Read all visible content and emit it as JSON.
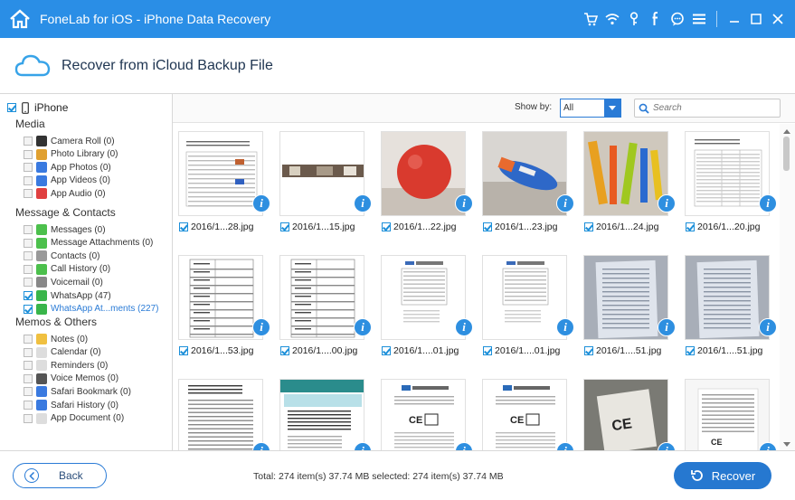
{
  "app": {
    "title": "FoneLab for iOS - iPhone Data Recovery"
  },
  "titlebar": {
    "tools": [
      {
        "name": "cart-icon",
        "glyph": "🛒"
      },
      {
        "name": "wifi-icon",
        "glyph": "≋"
      },
      {
        "name": "key-icon",
        "glyph": "♀"
      },
      {
        "name": "facebook-icon",
        "glyph": "f"
      },
      {
        "name": "chat-icon",
        "glyph": "☺"
      },
      {
        "name": "menu-icon",
        "glyph": "≡"
      }
    ],
    "window": [
      {
        "name": "minimize-button",
        "glyph": "—"
      },
      {
        "name": "maximize-button",
        "glyph": "☐"
      },
      {
        "name": "close-button",
        "glyph": "✕"
      }
    ]
  },
  "header": {
    "title": "Recover from iCloud Backup File"
  },
  "sidebar": {
    "root_label": "iPhone",
    "groups": [
      {
        "title": "Media",
        "items": [
          {
            "label": "Camera Roll (0)",
            "icon_color": "#333333",
            "checked": false
          },
          {
            "label": "Photo Library (0)",
            "icon_color": "#e0a030",
            "checked": false
          },
          {
            "label": "App Photos (0)",
            "icon_color": "#3a7ae0",
            "checked": false
          },
          {
            "label": "App Videos (0)",
            "icon_color": "#3a7ae0",
            "checked": false
          },
          {
            "label": "App Audio (0)",
            "icon_color": "#e04040",
            "checked": false
          }
        ]
      },
      {
        "title": "Message & Contacts",
        "items": [
          {
            "label": "Messages (0)",
            "icon_color": "#4cc04c",
            "checked": false
          },
          {
            "label": "Message Attachments (0)",
            "icon_color": "#4cc04c",
            "checked": false
          },
          {
            "label": "Contacts (0)",
            "icon_color": "#999999",
            "checked": false
          },
          {
            "label": "Call History (0)",
            "icon_color": "#4cc04c",
            "checked": false
          },
          {
            "label": "Voicemail (0)",
            "icon_color": "#888888",
            "checked": false
          },
          {
            "label": "WhatsApp (47)",
            "icon_color": "#39b54a",
            "checked": true
          },
          {
            "label": "WhatsApp At...ments (227)",
            "icon_color": "#39b54a",
            "checked": true
          }
        ]
      },
      {
        "title": "Memos & Others",
        "items": [
          {
            "label": "Notes (0)",
            "icon_color": "#f0c040",
            "checked": false
          },
          {
            "label": "Calendar (0)",
            "icon_color": "#dddddd",
            "checked": false
          },
          {
            "label": "Reminders (0)",
            "icon_color": "#dddddd",
            "checked": false
          },
          {
            "label": "Voice Memos (0)",
            "icon_color": "#555555",
            "checked": false
          },
          {
            "label": "Safari Bookmark (0)",
            "icon_color": "#3a7ae0",
            "checked": false
          },
          {
            "label": "Safari History (0)",
            "icon_color": "#3a7ae0",
            "checked": false
          },
          {
            "label": "App Document (0)",
            "icon_color": "#dddddd",
            "checked": false
          }
        ]
      }
    ]
  },
  "toolbar": {
    "show_by_label": "Show by:",
    "show_by_value": "All",
    "search_placeholder": "Search"
  },
  "files": [
    {
      "name": "2016/1...28.jpg",
      "thumb": "doc-table"
    },
    {
      "name": "2016/1...15.jpg",
      "thumb": "strip"
    },
    {
      "name": "2016/1...22.jpg",
      "thumb": "red-ball"
    },
    {
      "name": "2016/1...23.jpg",
      "thumb": "blue-bottle"
    },
    {
      "name": "2016/1...24.jpg",
      "thumb": "toys"
    },
    {
      "name": "2016/1...20.jpg",
      "thumb": "spreadsheet"
    },
    {
      "name": "2016/1...53.jpg",
      "thumb": "form"
    },
    {
      "name": "2016/1....00.jpg",
      "thumb": "form"
    },
    {
      "name": "2016/1....01.jpg",
      "thumb": "small-doc"
    },
    {
      "name": "2016/1....01.jpg",
      "thumb": "small-doc"
    },
    {
      "name": "2016/1....51.jpg",
      "thumb": "scan"
    },
    {
      "name": "2016/1....51.jpg",
      "thumb": "scan"
    },
    {
      "name": "",
      "thumb": "text-page"
    },
    {
      "name": "",
      "thumb": "web-page"
    },
    {
      "name": "",
      "thumb": "ce-doc"
    },
    {
      "name": "",
      "thumb": "ce-doc"
    },
    {
      "name": "",
      "thumb": "ce-photo"
    },
    {
      "name": "",
      "thumb": "ce-label"
    }
  ],
  "footer": {
    "back_label": "Back",
    "status": "Total: 274 item(s) 37.74 MB   selected: 274 item(s) 37.74 MB",
    "recover_label": "Recover"
  },
  "colors": {
    "accent": "#2a8ee6",
    "button": "#2678d0",
    "info": "#2e8fe0"
  }
}
